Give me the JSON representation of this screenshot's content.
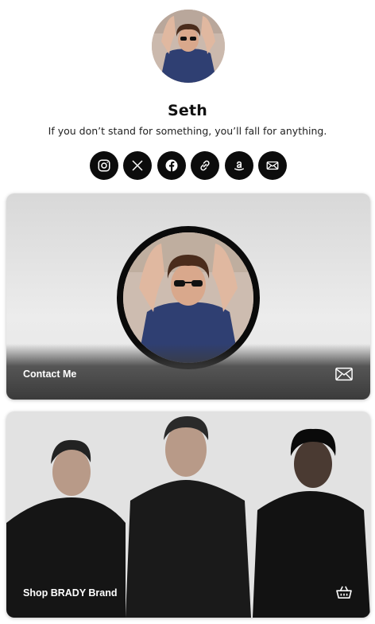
{
  "profile": {
    "name": "Seth",
    "bio": "If you don’t stand for something, you’ll fall for anything."
  },
  "socials": [
    {
      "icon": "instagram-icon"
    },
    {
      "icon": "x-icon"
    },
    {
      "icon": "facebook-icon"
    },
    {
      "icon": "link-icon"
    },
    {
      "icon": "amazon-icon"
    },
    {
      "icon": "mail-icon"
    }
  ],
  "cards": [
    {
      "label": "Contact Me",
      "icon": "mail-icon"
    },
    {
      "label": "Shop BRADY Brand",
      "icon": "basket-icon"
    }
  ],
  "colors": {
    "icon_bg": "#0c0c0c",
    "card_label": "#ffffff"
  }
}
